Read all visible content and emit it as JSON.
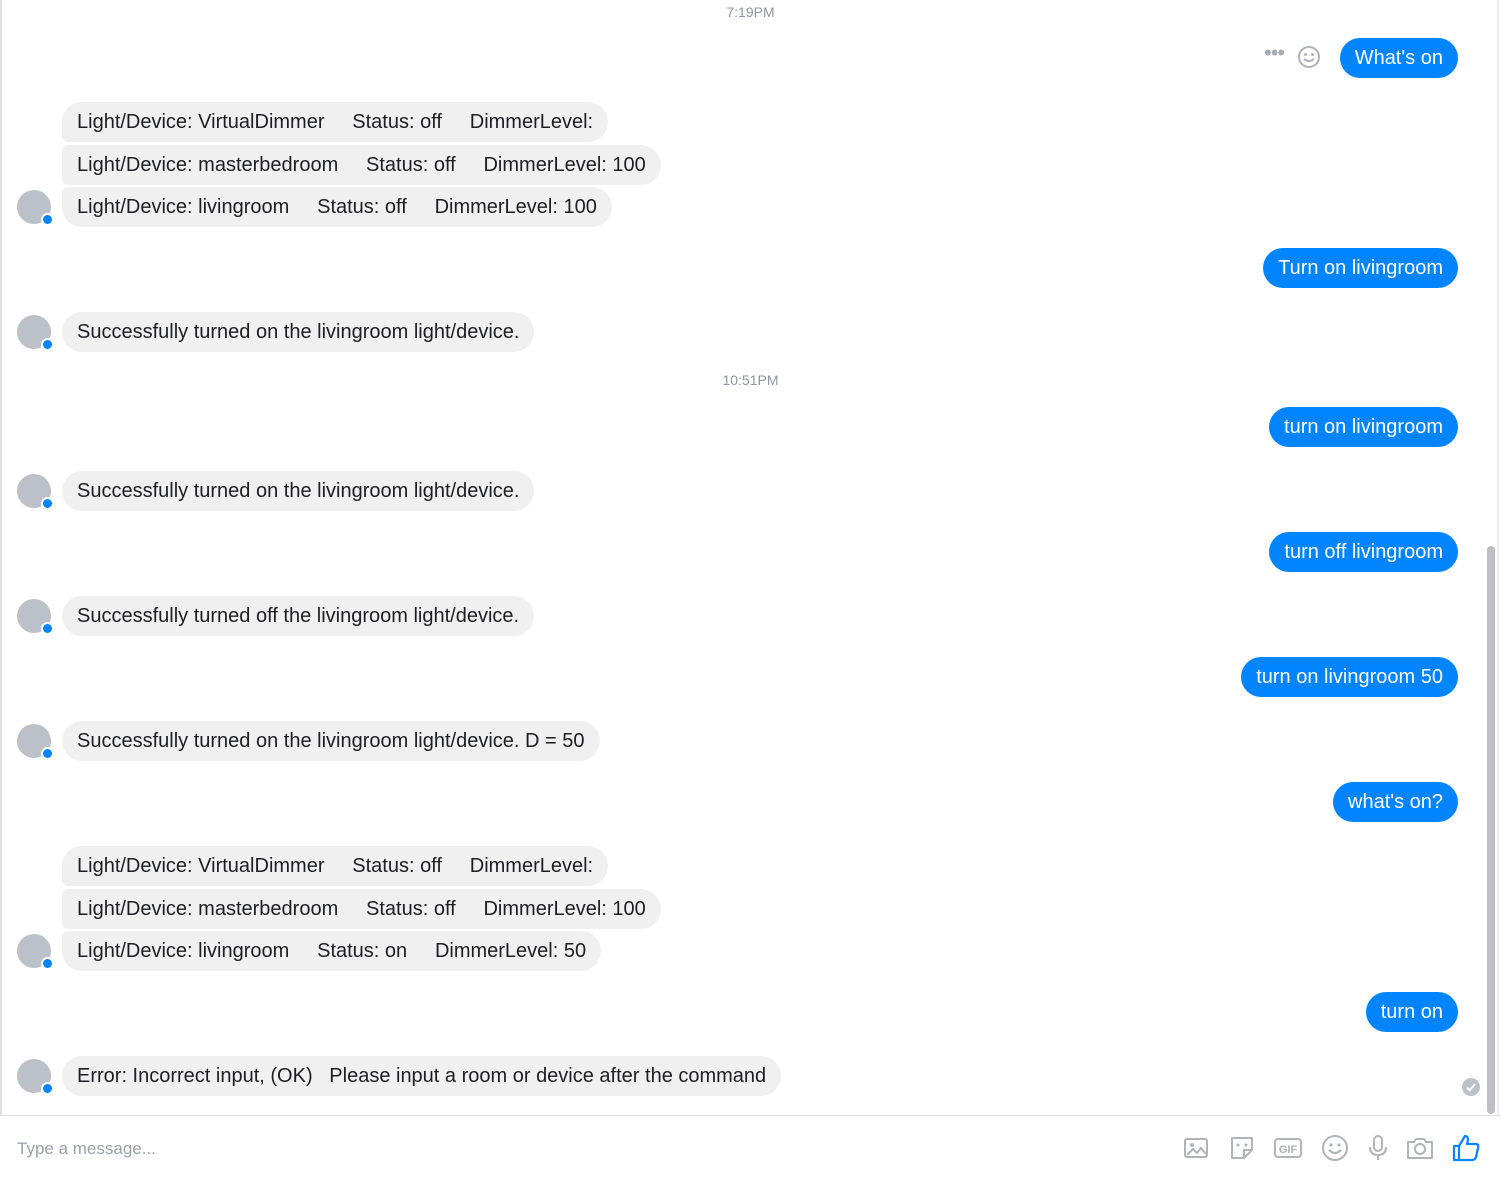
{
  "colors": {
    "outgoing_bubble": "#0084ff",
    "incoming_bubble": "#f1f0f0",
    "timestamp": "#90949c",
    "icon_gray": "#b0b3b8",
    "like_blue": "#0084ff"
  },
  "timestamps": {
    "first": "7:19PM",
    "second": "10:51PM"
  },
  "messages": {
    "m1": "What's on",
    "m2a": "Light/Device: VirtualDimmer     Status: off     DimmerLevel:",
    "m2b": "Light/Device: masterbedroom     Status: off     DimmerLevel: 100",
    "m2c": "Light/Device: livingroom     Status: off     DimmerLevel: 100",
    "m3": "Turn on livingroom",
    "m4": "Successfully turned on the livingroom light/device.",
    "m5": "turn on livingroom",
    "m6": "Successfully turned on the livingroom light/device.",
    "m7": "turn off livingroom",
    "m8": "Successfully turned off the livingroom light/device.",
    "m9": "turn on livingroom 50",
    "m10": "Successfully turned on the livingroom light/device. D = 50",
    "m11": "what's on?",
    "m12a": "Light/Device: VirtualDimmer     Status: off     DimmerLevel:",
    "m12b": "Light/Device: masterbedroom     Status: off     DimmerLevel: 100",
    "m12c": "Light/Device: livingroom     Status: on     DimmerLevel: 50",
    "m13": "turn on",
    "m14": "Error: Incorrect input, (OK)   Please input a room or device after the command"
  },
  "composer": {
    "placeholder": "Type a message...",
    "icons": [
      "image-icon",
      "sticker-icon",
      "gif-icon",
      "emoji-icon",
      "microphone-icon",
      "camera-icon",
      "like-icon"
    ],
    "gif_label": "GIF"
  }
}
